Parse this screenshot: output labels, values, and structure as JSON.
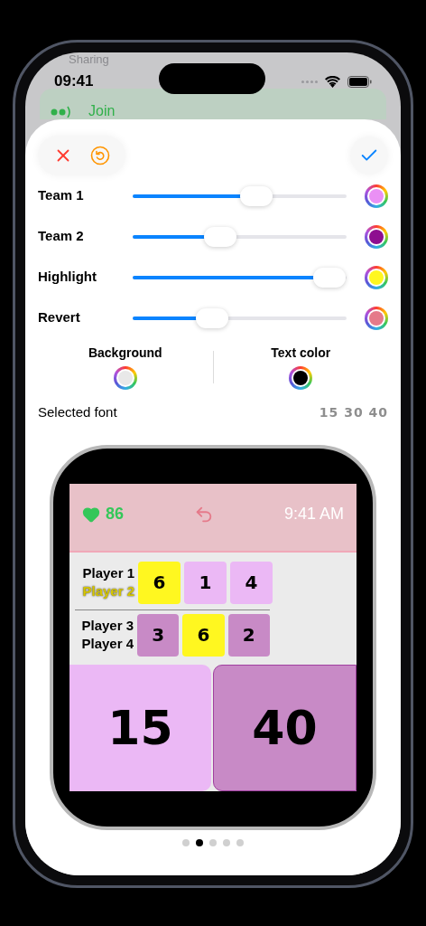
{
  "background_app": {
    "header": "Sharing",
    "status_bar": {
      "time": "09:41"
    },
    "banner": {
      "label": "Join"
    }
  },
  "sheet": {
    "sliders": [
      {
        "label": "Team 1",
        "level": 0.58,
        "color": "#ea90f5"
      },
      {
        "label": "Team 2",
        "level": 0.41,
        "color": "#8e0e90"
      },
      {
        "label": "Highlight",
        "level": 0.92,
        "color": "#fff720"
      },
      {
        "label": "Revert",
        "level": 0.37,
        "color": "#e57a8a"
      }
    ],
    "swatches": [
      {
        "label": "Background",
        "color": "#e8e8e8"
      },
      {
        "label": "Text color",
        "color": "#000000"
      }
    ],
    "font": {
      "label": "Selected font",
      "preview": "15 30 40"
    },
    "watch": {
      "heart_rate": "86",
      "time": "9:41 AM",
      "rows": [
        {
          "color": "#ebb8f5",
          "players": [
            {
              "name": "Player 1",
              "highlighted": false
            },
            {
              "name": "Player 2",
              "highlighted": true
            }
          ],
          "games": [
            {
              "value": "6",
              "highlighted": true
            },
            {
              "value": "1",
              "highlighted": false
            },
            {
              "value": "4",
              "highlighted": false
            }
          ]
        },
        {
          "color": "#c88ac6",
          "players": [
            {
              "name": "Player 3",
              "highlighted": false
            },
            {
              "name": "Player 4",
              "highlighted": false
            }
          ],
          "games": [
            {
              "value": "3",
              "highlighted": false
            },
            {
              "value": "6",
              "highlighted": true
            },
            {
              "value": "2",
              "highlighted": false
            }
          ]
        }
      ],
      "scores": [
        {
          "value": "15",
          "color": "#ebb8f5"
        },
        {
          "value": "40",
          "color": "#c88ac6"
        }
      ]
    },
    "pages": [
      {
        "selected": false
      },
      {
        "selected": true
      },
      {
        "selected": false
      },
      {
        "selected": false
      },
      {
        "selected": false
      }
    ]
  }
}
